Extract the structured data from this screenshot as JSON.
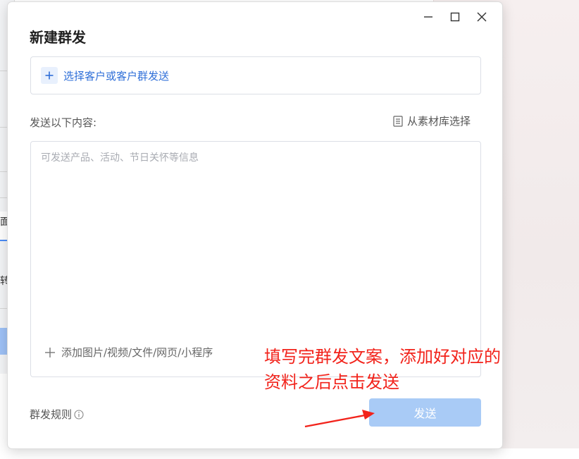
{
  "background_app": {
    "fragment_text_1": "面",
    "fragment_text_2": "转"
  },
  "dialog": {
    "title": "新建群发",
    "window_controls": {
      "minimize_icon": "minimize-icon",
      "maximize_icon": "maximize-icon",
      "close_icon": "close-icon"
    },
    "recipient": {
      "icon": "plus-icon",
      "label": "选择客户或客户群发送"
    },
    "content_section": {
      "label": "发送以下内容:",
      "library_link_icon": "document-icon",
      "library_link": "从素材库选择",
      "textarea_value": "",
      "textarea_placeholder": "可发送产品、活动、节日关怀等信息",
      "attach_icon": "plus-icon",
      "attach_label": "添加图片/视频/文件/网页/小程序"
    },
    "footer": {
      "rules_label": "群发规则",
      "rules_icon": "info-icon",
      "send_label": "发送"
    }
  },
  "annotation": {
    "line1": "填写完群发文案，添加好对应的",
    "line2": "资料之后点击发送",
    "color": "#f2231b"
  },
  "colors": {
    "accent": "#2f6fd8",
    "send_button_disabled": "#a9cbf6"
  }
}
